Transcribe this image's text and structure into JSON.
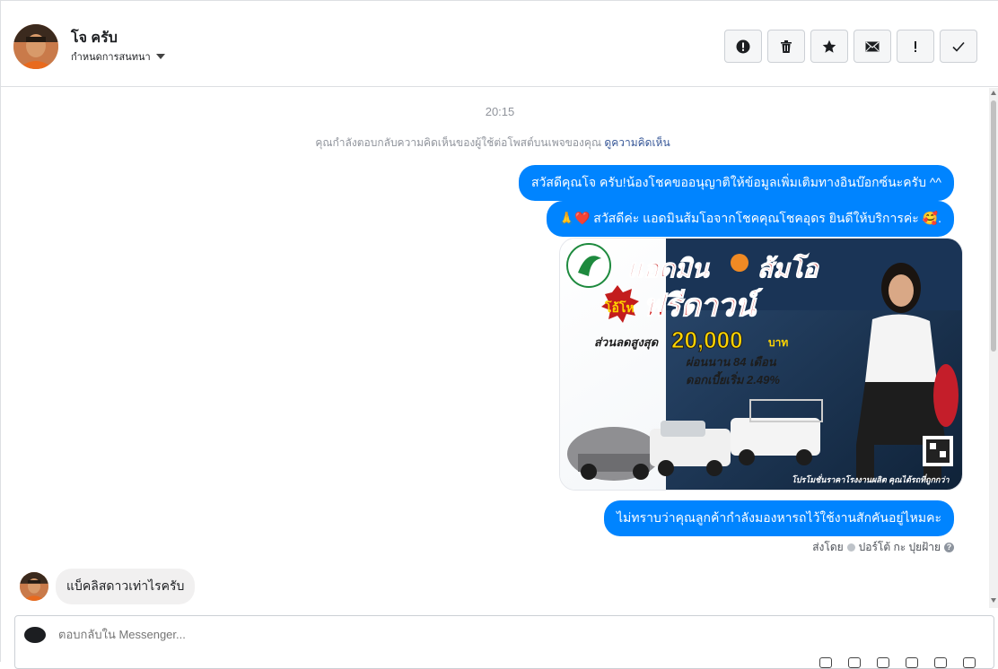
{
  "header": {
    "contact_name": "โจ ครับ",
    "assign_label": "กำหนดการสนทนา",
    "actions": [
      {
        "icon": "alert-circle-icon",
        "name": "mark-spam-button"
      },
      {
        "icon": "trash-icon",
        "name": "delete-button"
      },
      {
        "icon": "star-icon",
        "name": "star-button"
      },
      {
        "icon": "envelope-icon",
        "name": "mark-unread-button"
      },
      {
        "icon": "exclamation-icon",
        "name": "follow-up-button"
      },
      {
        "icon": "check-icon",
        "name": "mark-done-button"
      }
    ]
  },
  "conversation": {
    "timestamp": "20:15",
    "notice_text": "คุณกำลังตอบกลับความคิดเห็นของผู้ใช้ต่อโพสต์บนเพจของคุณ",
    "notice_link": "ดูความคิดเห็น",
    "outgoing": [
      "สวัสดีคุณโจ ครับ!น้องโชคขออนุญาติให้ข้อมูลเพิ่มเติมทางอินบ๊อกซ์นะครับ ^^",
      "🙏❤️ สวัสดีค่ะ แอดมินส้มโอจากโชคคุณโชคอุดร ยินดีให้บริการค่ะ 🥰.",
      "ไม่ทราบว่าคุณลูกค้ากำลังมองหารถไว้ใช้งานสักคันอยู่ไหมคะ"
    ],
    "promo_image": {
      "headline": "แอดมิน",
      "name": "ส้มโอ",
      "badge": "โอ้โห",
      "offer": "ฟรีดาวน์",
      "discount_label": "ส่วนลดสูงสุด",
      "discount_value": "20,000",
      "discount_unit": "บาท",
      "installment": "ผ่อนนาน 84 เดือน",
      "interest": "ดอกเบี้ยเริ่ม 2.49%",
      "footer": "โปรโมชั่นราคาโรงงานผลิต คุณได้รถที่ถูกกว่า"
    },
    "sent_by_label": "ส่งโดย",
    "sent_by_name": "ปอร์โต้ กะ ปุยฝ้าย",
    "incoming": [
      "แบ็คลิสดาวเท่าไรครับ"
    ]
  },
  "composer": {
    "placeholder": "ตอบกลับใน Messenger..."
  },
  "colors": {
    "outgoing_bubble": "#0084ff",
    "incoming_bubble": "#f1f0f0",
    "link": "#385898"
  }
}
